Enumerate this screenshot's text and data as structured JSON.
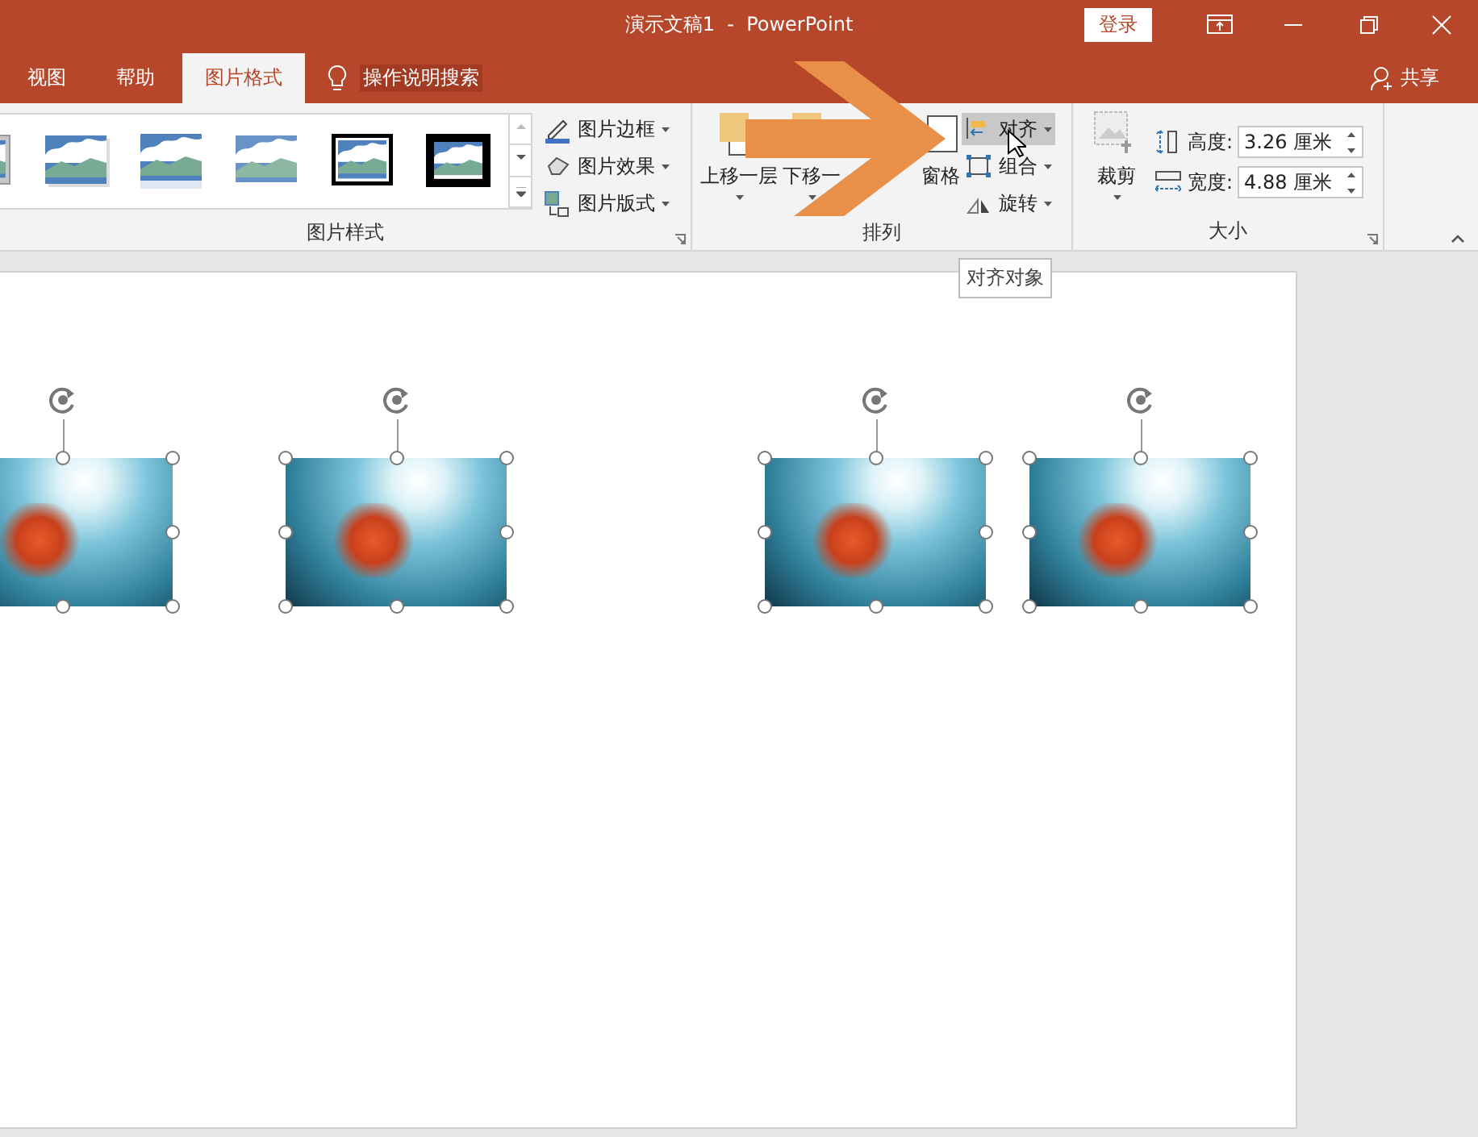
{
  "window": {
    "title": "演示文稿1  -  PowerPoint",
    "sign_in": "登录"
  },
  "tabs": [
    {
      "label": "视图",
      "selected": false
    },
    {
      "label": "帮助",
      "selected": false
    },
    {
      "label": "图片格式",
      "selected": true
    }
  ],
  "tell_me": "操作说明搜索",
  "share": "共享",
  "picture_styles": {
    "label": "图片样式",
    "styles": [
      {
        "kind": "thick-frame"
      },
      {
        "kind": "shadow"
      },
      {
        "kind": "reflection"
      },
      {
        "kind": "soft-edge"
      },
      {
        "kind": "double-frame"
      },
      {
        "kind": "black-frame"
      }
    ],
    "commands": [
      {
        "kind": "border",
        "label": "图片边框"
      },
      {
        "kind": "effects",
        "label": "图片效果"
      },
      {
        "kind": "layout",
        "label": "图片版式"
      }
    ]
  },
  "arrange": {
    "label": "排列",
    "large": [
      {
        "kind": "forward",
        "label": "上移一层"
      },
      {
        "kind": "backward",
        "label": "下移一"
      },
      {
        "kind": "pane",
        "label": "窗格"
      }
    ],
    "small": [
      {
        "kind": "align",
        "label": "对齐",
        "highlighted": true
      },
      {
        "kind": "group",
        "label": "组合",
        "highlighted": false
      },
      {
        "kind": "rotate",
        "label": "旋转",
        "highlighted": false
      }
    ]
  },
  "size": {
    "label": "大小",
    "crop": "裁剪",
    "fields": [
      {
        "kind": "height",
        "label": "高度:",
        "value": "3.26 厘米"
      },
      {
        "kind": "width",
        "label": "宽度:",
        "value": "4.88 厘米"
      }
    ]
  },
  "tooltip": "对齐对象",
  "photos": [
    {
      "selected": true
    },
    {
      "selected": true
    },
    {
      "selected": true
    },
    {
      "selected": true
    }
  ]
}
